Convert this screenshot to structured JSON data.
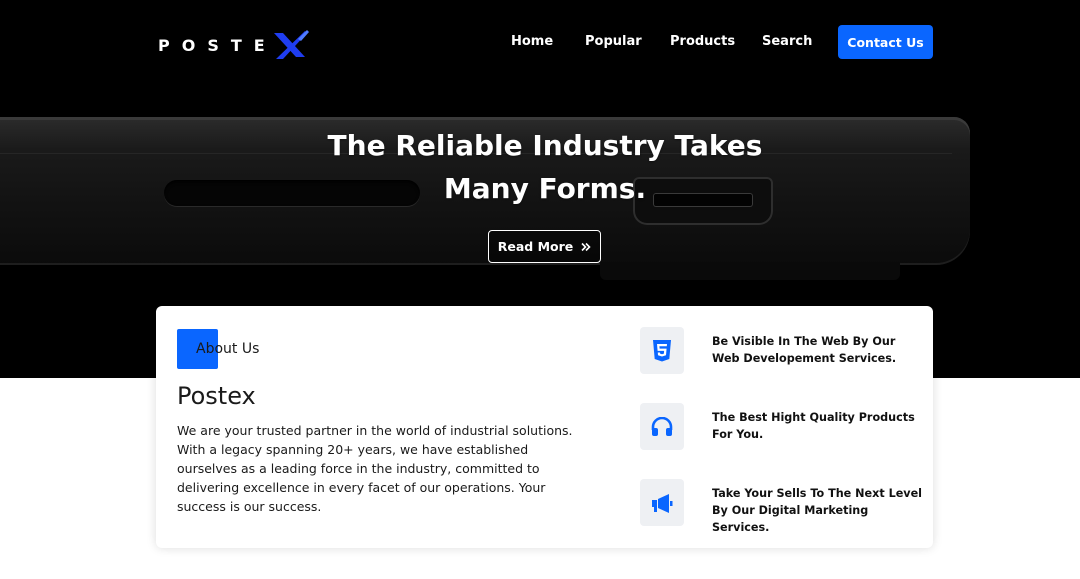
{
  "brand": {
    "name": "POSTE"
  },
  "nav": {
    "items": [
      {
        "label": "Home"
      },
      {
        "label": "Popular"
      },
      {
        "label": "Products"
      },
      {
        "label": "Search"
      }
    ],
    "cta_label": "Contact Us"
  },
  "hero": {
    "headline_line1": "The Reliable Industry Takes",
    "headline_line2": "Many Forms.",
    "button_label": "Read More",
    "button_icon": "double-chevron-right-icon"
  },
  "about": {
    "label": "About Us",
    "title": "Postex",
    "description": "We are your trusted partner in the world of industrial solutions. With a legacy spanning 20+ years, we have established ourselves as a leading force in the industry, committed to delivering excellence in every facet of our operations. Your success is our success."
  },
  "services": [
    {
      "icon": "html5-icon",
      "text": "Be Visible In The Web By Our Web Developement Services."
    },
    {
      "icon": "headphones-icon",
      "text": "The Best Hight Quality Products For You."
    },
    {
      "icon": "megaphone-icon",
      "text": "Take Your Sells To The Next Level By Our Digital Marketing Services."
    }
  ],
  "colors": {
    "accent": "#0a66ff",
    "hero_bg": "#000000",
    "icon_bg": "#eef0f3"
  }
}
